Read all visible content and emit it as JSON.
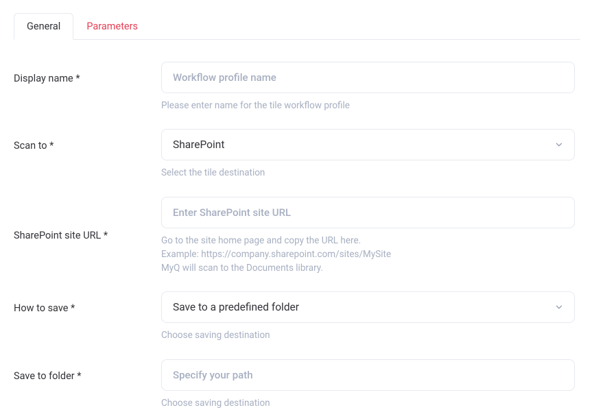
{
  "tabs": {
    "general": "General",
    "parameters": "Parameters"
  },
  "fields": {
    "displayName": {
      "label": "Display name *",
      "placeholder": "Workflow profile name",
      "value": "",
      "help": "Please enter name for the tile workflow profile"
    },
    "scanTo": {
      "label": "Scan to *",
      "value": "SharePoint",
      "help": "Select the tile destination"
    },
    "siteUrl": {
      "label": "SharePoint site URL *",
      "placeholder": "Enter SharePoint site URL",
      "value": "",
      "helpLine1": "Go to the site home page and copy the URL here.",
      "helpLine2": "Example: https://company.sharepoint.com/sites/MySite",
      "helpLine3": "MyQ will scan to the Documents library."
    },
    "howToSave": {
      "label": "How to save *",
      "value": "Save to a predefined folder",
      "help": "Choose saving destination"
    },
    "saveToFolder": {
      "label": "Save to folder *",
      "placeholder": "Specify your path",
      "value": "",
      "help": "Choose saving destination"
    }
  }
}
